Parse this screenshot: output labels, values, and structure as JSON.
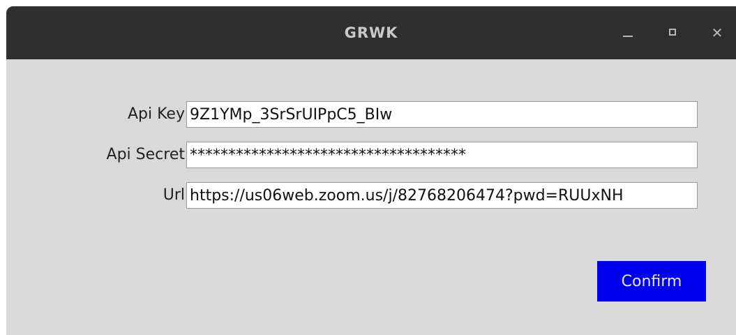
{
  "window": {
    "title": "GRWK",
    "minimize_label": "–",
    "maximize_label": "□",
    "close_label": "✕"
  },
  "form": {
    "api_key": {
      "label": "Api Key",
      "value": "9Z1YMp_3SrSrUIPpC5_BIw"
    },
    "api_secret": {
      "label": "Api Secret",
      "value": "************************************"
    },
    "url": {
      "label": "Url",
      "value": "https://us06web.zoom.us/j/82768206474?pwd=RUUxNH"
    }
  },
  "actions": {
    "confirm_label": "Confirm"
  },
  "colors": {
    "titlebar": "#2f2f2f",
    "window_bg": "#d9d9d9",
    "confirm_bg": "#0000ee"
  }
}
